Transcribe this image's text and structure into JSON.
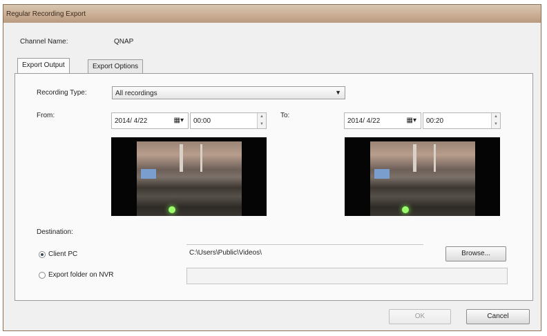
{
  "window": {
    "title": "Regular Recording Export"
  },
  "channel": {
    "label": "Channel Name:",
    "value": "QNAP"
  },
  "tabs": [
    {
      "label": "Export Output"
    },
    {
      "label": "Export Options"
    }
  ],
  "recording_type": {
    "label": "Recording Type:",
    "value": "All recordings"
  },
  "from": {
    "label": "From:",
    "date": "2014/ 4/22",
    "time": "00:00"
  },
  "to": {
    "label": "To:",
    "date": "2014/ 4/22",
    "time": "00:20"
  },
  "destination": {
    "label": "Destination:",
    "client_pc_label": "Client PC",
    "nvr_label": "Export folder on NVR",
    "path": "C:\\Users\\Public\\Videos\\",
    "browse_label": "Browse..."
  },
  "buttons": {
    "ok": "OK",
    "cancel": "Cancel"
  }
}
